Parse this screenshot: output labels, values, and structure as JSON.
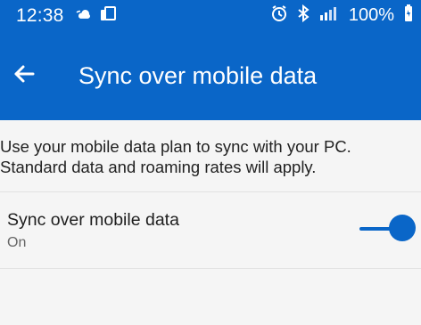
{
  "status_bar": {
    "time": "12:38",
    "battery_text": "100%",
    "icons_left": [
      "weather-icon",
      "phone-tablet-icon"
    ],
    "icons_right": [
      "alarm-icon",
      "bluetooth-icon",
      "signal-icon",
      "battery-icon"
    ]
  },
  "header": {
    "title": "Sync over mobile data",
    "back_icon": "arrow-left-icon",
    "background_color": "#0a66c8"
  },
  "content": {
    "description": "Use your mobile data plan to sync with your PC. Standard data and roaming rates will apply.",
    "setting": {
      "title": "Sync over mobile data",
      "subtitle": "On",
      "toggle_state": "on",
      "accent_color": "#0a66c8"
    }
  }
}
